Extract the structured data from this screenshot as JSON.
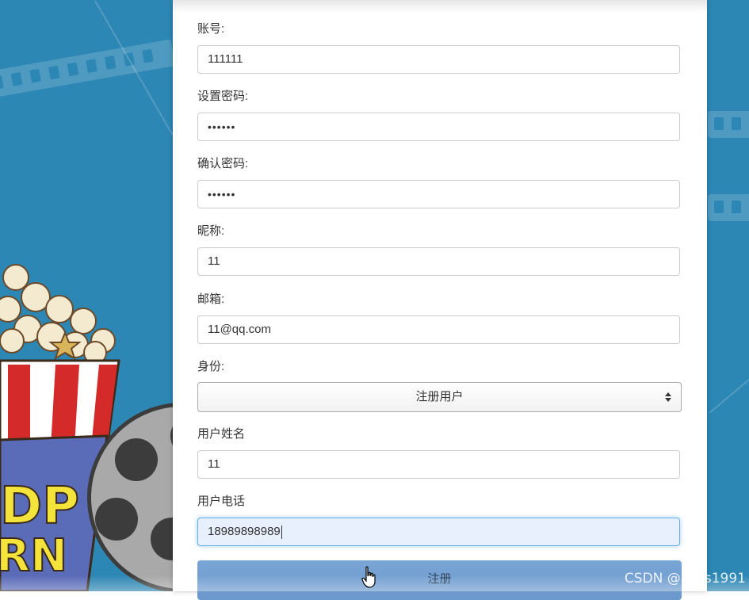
{
  "form": {
    "account": {
      "label": "账号:",
      "value": "111111"
    },
    "password": {
      "label": "设置密码:",
      "value": "••••••"
    },
    "confirm_password": {
      "label": "确认密码:",
      "value": "••••••"
    },
    "nickname": {
      "label": "昵称:",
      "value": "11"
    },
    "email": {
      "label": "邮箱:",
      "value": "11@qq.com"
    },
    "role": {
      "label": "身份:",
      "selected": "注册用户"
    },
    "user_name": {
      "label": "用户姓名",
      "value": "11"
    },
    "user_phone": {
      "label": "用户电话",
      "value": "18989898989"
    },
    "submit_label": "注册"
  },
  "watermark": "CSDN @kybs1991",
  "colors": {
    "background": "#2d87b4",
    "card": "#ffffff",
    "submit": "#6a98cc",
    "focus_border": "#66afe9"
  },
  "icons": {
    "select_arrow": "sort-arrows-icon",
    "cursor": "hand-pointer-icon"
  }
}
